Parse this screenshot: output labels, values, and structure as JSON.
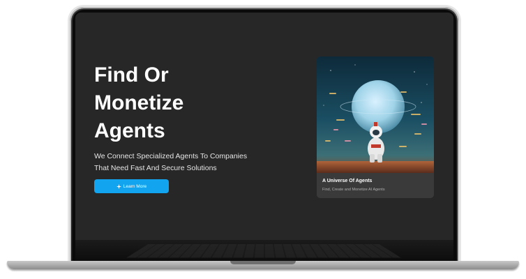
{
  "hero": {
    "title_lines": [
      "Find Or",
      "Monetize",
      "Agents"
    ],
    "subtitle_lines": [
      "We Connect Specialized Agents To Companies",
      "That Need Fast And Secure Solutions"
    ],
    "cta_label": "Learn More",
    "cta_icon": "sparkle-icon"
  },
  "card": {
    "title": "A Universe Of Agents",
    "description": "Find, Create and Monetize AI Agents"
  },
  "colors": {
    "screen_bg": "#272727",
    "accent": "#12a4ee",
    "card_bg": "#3a3a3a"
  }
}
